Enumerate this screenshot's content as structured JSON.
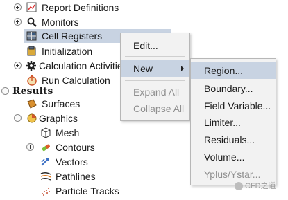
{
  "tree": {
    "report_definitions": "Report Definitions",
    "monitors": "Monitors",
    "cell_registers": "Cell Registers",
    "initialization": "Initialization",
    "calculation_activities": "Calculation Activitie",
    "run_calculation": "Run Calculation",
    "results": "Results",
    "surfaces": "Surfaces",
    "graphics": "Graphics",
    "mesh": "Mesh",
    "contours": "Contours",
    "vectors": "Vectors",
    "pathlines": "Pathlines",
    "particle_tracks": "Particle Tracks"
  },
  "context_menu": {
    "edit": "Edit...",
    "new": "New",
    "expand_all": "Expand All",
    "collapse_all": "Collapse All"
  },
  "submenu": {
    "region": "Region...",
    "boundary": "Boundary...",
    "field_variable": "Field Variable...",
    "limiter": "Limiter...",
    "residuals": "Residuals...",
    "volume": "Volume...",
    "yplus_ystar": "Yplus/Ystar..."
  },
  "watermark": "CFD之道",
  "colors": {
    "selection": "#c8d3e2",
    "disabled_text": "#8f8f8f",
    "menu_bg": "#f2f2f2"
  }
}
